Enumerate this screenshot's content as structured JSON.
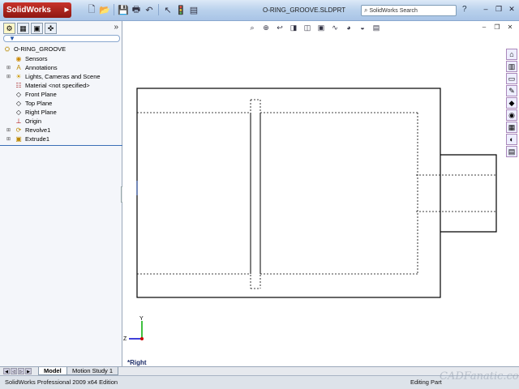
{
  "app": {
    "logo_text": "SolidWorks",
    "document_title": "O-RING_GROOVE.SLDPRT",
    "search_placeholder": "SolidWorks Search"
  },
  "toolbar": {
    "icons": [
      "new-icon",
      "open-icon",
      "save-icon",
      "print-icon",
      "undo-icon",
      "select-icon",
      "rebuild-icon",
      "options-icon"
    ]
  },
  "window_controls": [
    "minimize",
    "restore",
    "close"
  ],
  "feature_tree": {
    "root": "O-RING_GROOVE",
    "items": [
      {
        "label": "Sensors",
        "icon": "sensor-icon",
        "expandable": false
      },
      {
        "label": "Annotations",
        "icon": "annotations-icon",
        "expandable": true
      },
      {
        "label": "Lights, Cameras and Scene",
        "icon": "lights-icon",
        "expandable": true
      },
      {
        "label": "Material <not specified>",
        "icon": "material-icon",
        "expandable": false
      },
      {
        "label": "Front Plane",
        "icon": "plane-icon",
        "expandable": false
      },
      {
        "label": "Top Plane",
        "icon": "plane-icon",
        "expandable": false
      },
      {
        "label": "Right Plane",
        "icon": "plane-icon",
        "expandable": false
      },
      {
        "label": "Origin",
        "icon": "origin-icon",
        "expandable": false
      },
      {
        "label": "Revolve1",
        "icon": "revolve-icon",
        "expandable": true
      },
      {
        "label": "Extrude1",
        "icon": "extrude-icon",
        "expandable": true
      }
    ]
  },
  "viewport": {
    "view_label": "*Right",
    "axis_labels": {
      "y": "Y",
      "z": "Z"
    }
  },
  "bottom_tabs": [
    {
      "label": "Model",
      "active": true
    },
    {
      "label": "Motion Study 1",
      "active": false
    }
  ],
  "status": {
    "left": "SolidWorks Professional 2009 x64 Edition",
    "right": "Editing Part"
  },
  "watermark": "CADFanatic.com"
}
